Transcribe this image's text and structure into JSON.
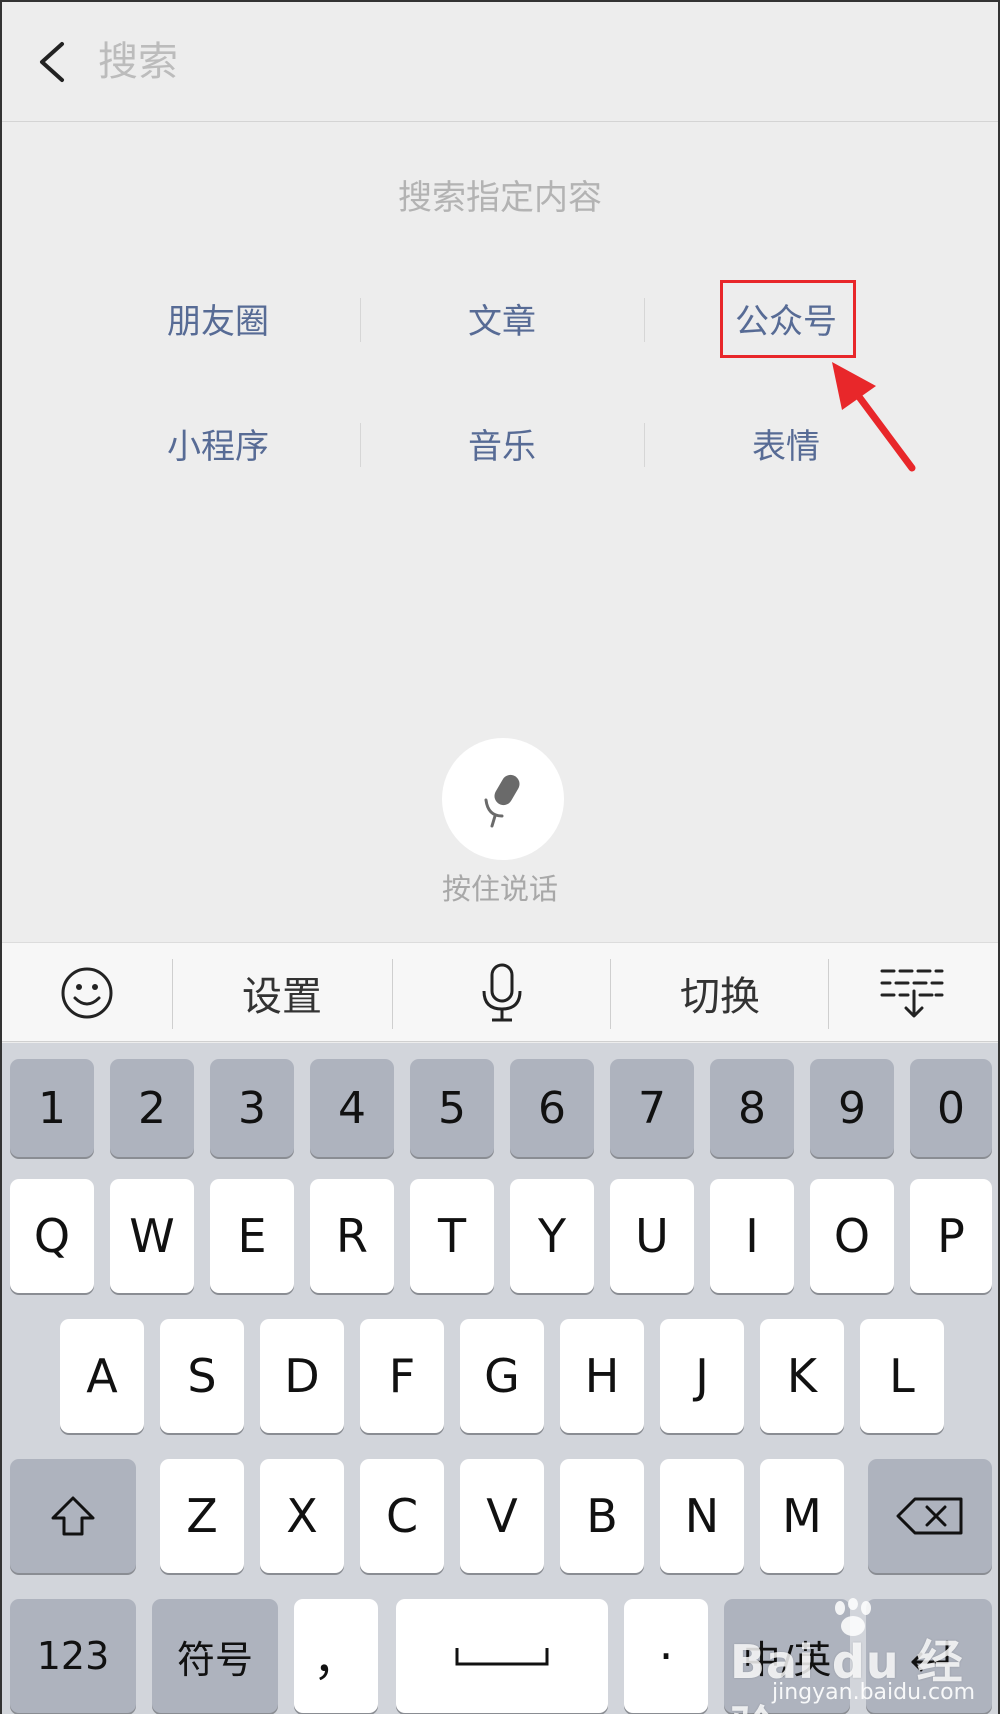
{
  "header": {
    "search_placeholder": "搜索"
  },
  "search_hint": "搜索指定内容",
  "categories": [
    {
      "label": "朋友圈"
    },
    {
      "label": "文章"
    },
    {
      "label": "公众号"
    },
    {
      "label": "小程序"
    },
    {
      "label": "音乐"
    },
    {
      "label": "表情"
    }
  ],
  "highlighted_category": "公众号",
  "voice": {
    "label": "按住说话"
  },
  "keyboard_toolbar": {
    "settings_label": "设置",
    "switch_label": "切换"
  },
  "keyboard": {
    "number_row": [
      "1",
      "2",
      "3",
      "4",
      "5",
      "6",
      "7",
      "8",
      "9",
      "0"
    ],
    "row1": [
      "Q",
      "W",
      "E",
      "R",
      "T",
      "Y",
      "U",
      "I",
      "O",
      "P"
    ],
    "row2": [
      "A",
      "S",
      "D",
      "F",
      "G",
      "H",
      "J",
      "K",
      "L"
    ],
    "row3": [
      "Z",
      "X",
      "C",
      "V",
      "B",
      "N",
      "M"
    ],
    "numbers_key": "123",
    "symbols_key": "符号",
    "comma_key": "，",
    "period_key": "·",
    "language_key": "中/英"
  },
  "watermark": {
    "brand": "Bai du 经验",
    "url": "jingyan.baidu.com"
  },
  "colors": {
    "link_blue": "#576b95",
    "highlight_red": "#e8272a",
    "keyboard_bg": "#d2d5db"
  }
}
